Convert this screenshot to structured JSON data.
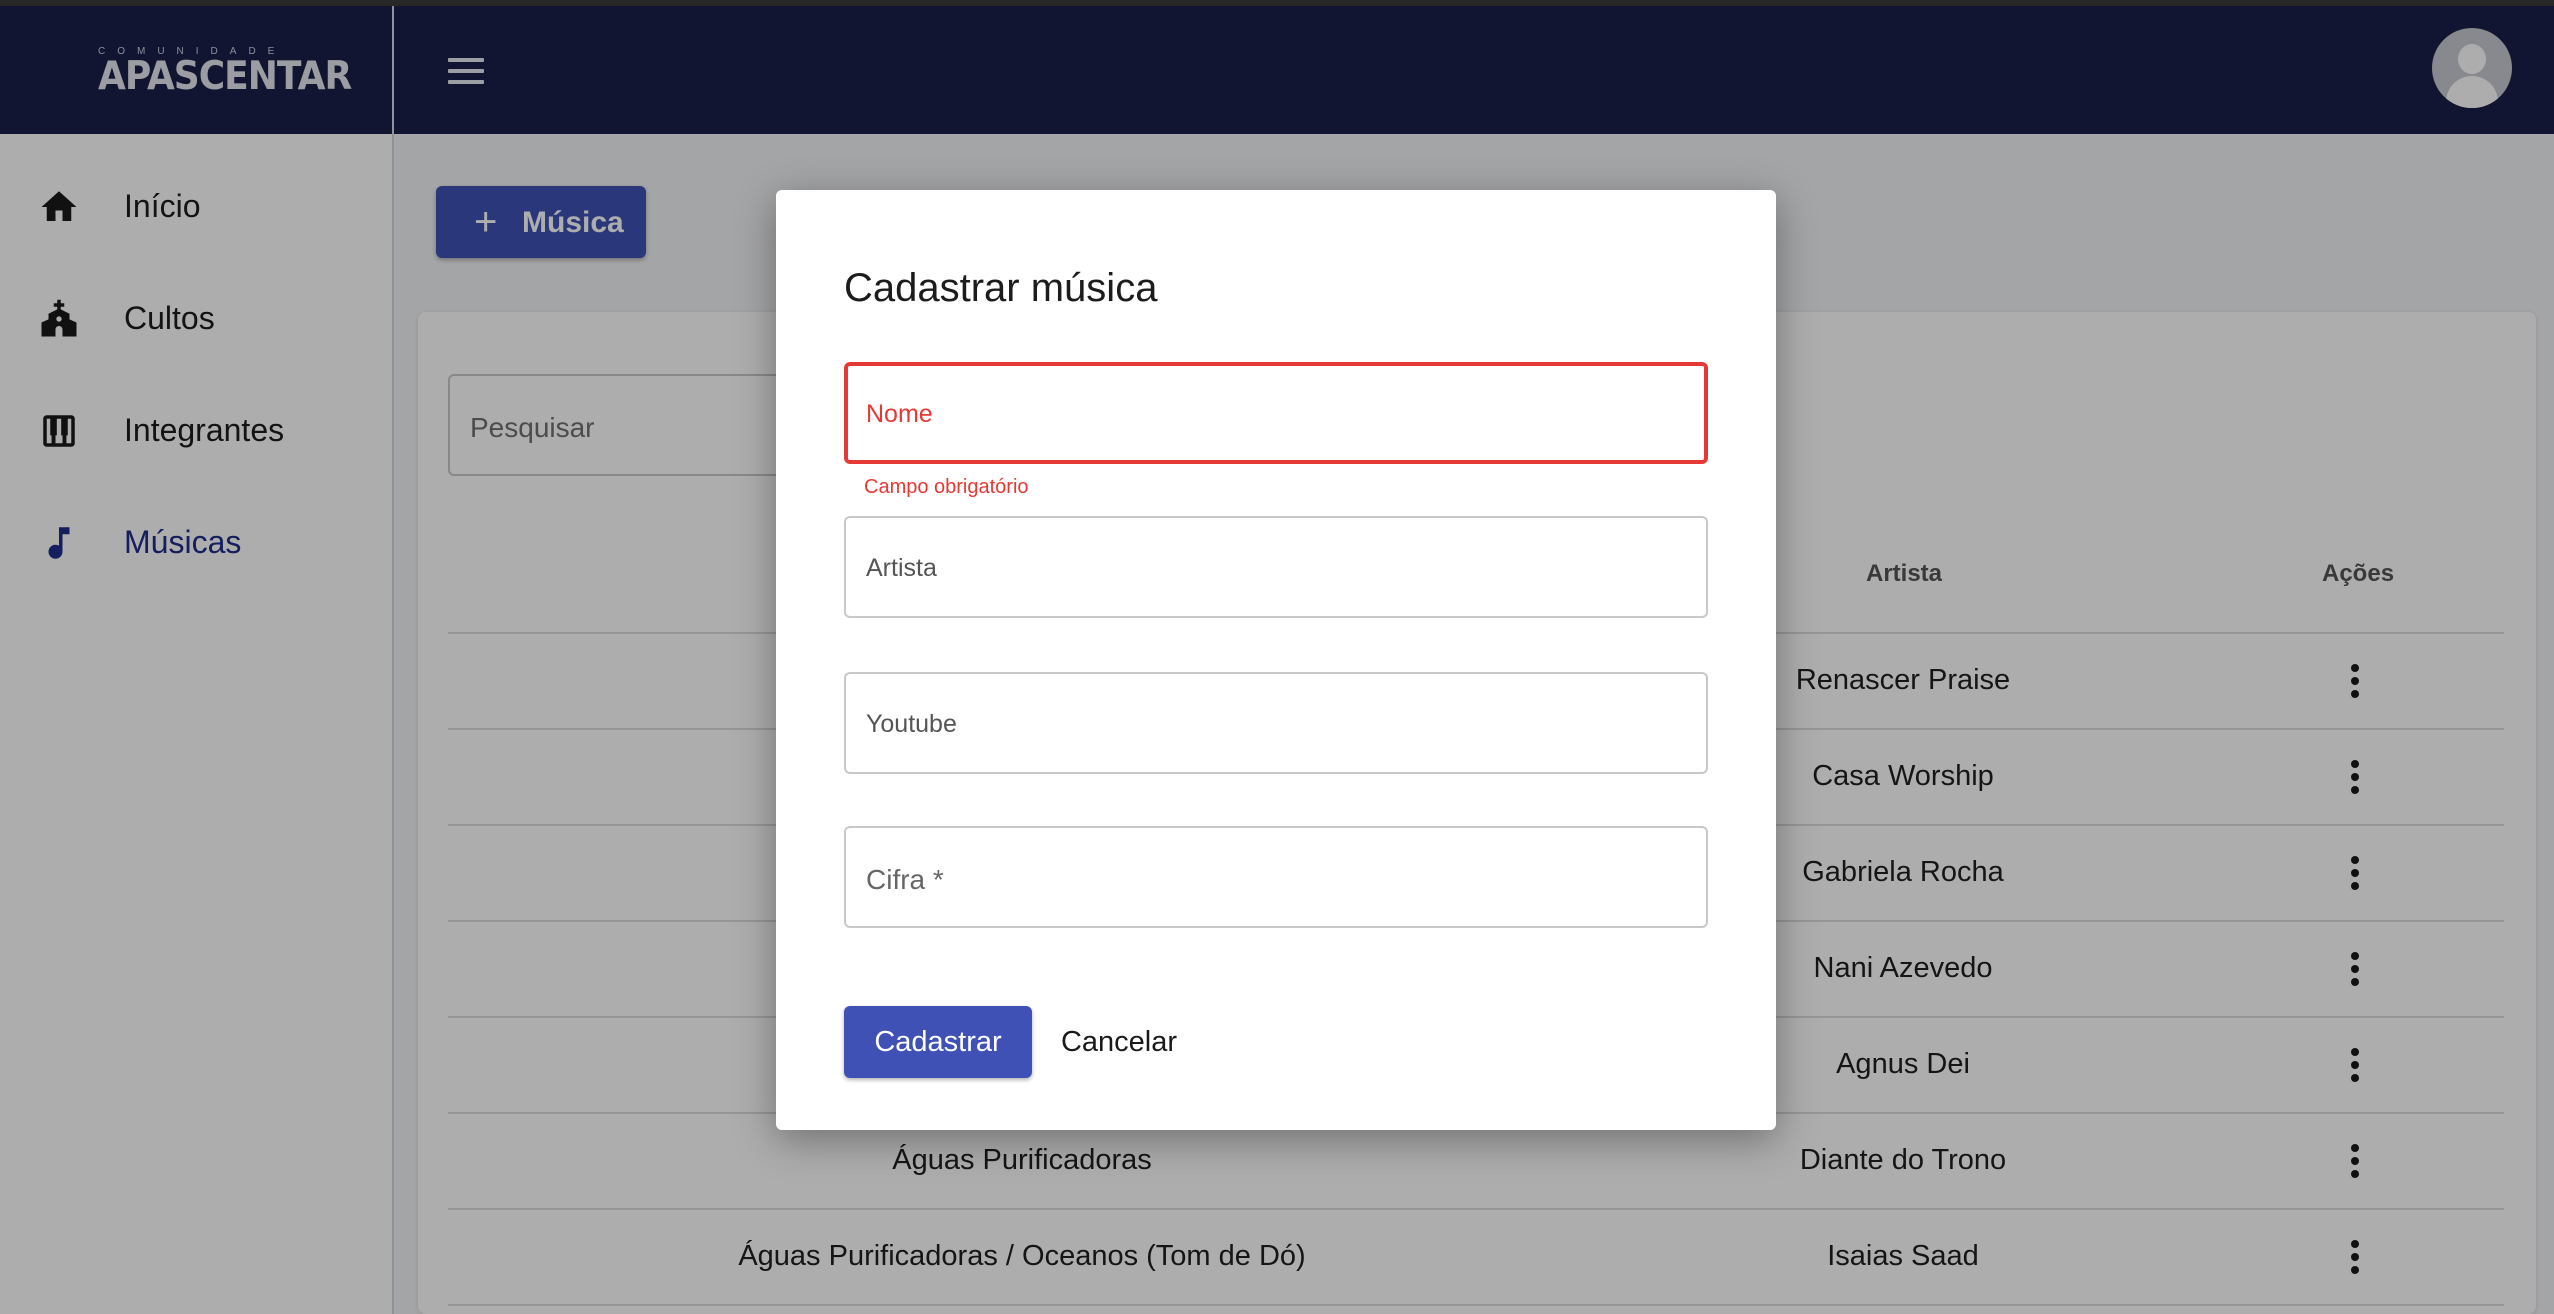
{
  "header": {
    "logo_small": "COMUNIDADE",
    "logo_main": "APASCENTAR"
  },
  "sidebar": {
    "items": [
      {
        "label": "Início",
        "icon": "home-icon"
      },
      {
        "label": "Cultos",
        "icon": "church-icon"
      },
      {
        "label": "Integrantes",
        "icon": "piano-icon"
      },
      {
        "label": "Músicas",
        "icon": "music-note-icon",
        "active": true
      }
    ]
  },
  "main": {
    "add_button_label": "Música",
    "search_placeholder": "Pesquisar",
    "table": {
      "columns": [
        "Artista",
        "Ações"
      ],
      "rows": [
        {
          "nome": "",
          "artista": "Renascer Praise"
        },
        {
          "nome": "",
          "artista": "Casa Worship"
        },
        {
          "nome": "",
          "artista": "Gabriela Rocha"
        },
        {
          "nome": "",
          "artista": "Nani Azevedo"
        },
        {
          "nome": "",
          "artista": "Agnus Dei"
        },
        {
          "nome": "Águas Purificadoras",
          "artista": "Diante do Trono"
        },
        {
          "nome": "Águas Purificadoras / Oceanos (Tom de Dó)",
          "artista": "Isaias Saad"
        }
      ]
    }
  },
  "dialog": {
    "title": "Cadastrar música",
    "fields": {
      "nome": "Nome",
      "nome_error": "Campo obrigatório",
      "artista": "Artista",
      "youtube": "Youtube",
      "cifra": "Cifra *"
    },
    "submit_label": "Cadastrar",
    "cancel_label": "Cancelar"
  },
  "colors": {
    "header_bg": "#1b2049",
    "primary": "#3f51b5",
    "active_nav": "#1f2d8c",
    "error": "#e53935"
  }
}
